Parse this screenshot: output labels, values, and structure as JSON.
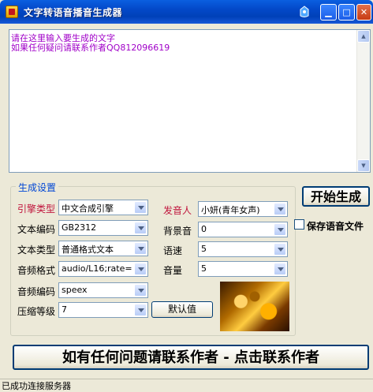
{
  "window": {
    "title": "文字转语音播音生成器"
  },
  "textarea": {
    "lines": [
      "请在这里输入要生成的文字",
      "如果任何疑问请联系作者QQ812096619"
    ]
  },
  "settings": {
    "group_title": "生成设置",
    "engine": {
      "label": "引擎类型",
      "value": "中文合成引擎"
    },
    "text_encoding": {
      "label": "文本编码",
      "value": "GB2312"
    },
    "text_type": {
      "label": "文本类型",
      "value": "普通格式文本"
    },
    "audio_format": {
      "label": "音频格式",
      "value": "audio/L16;rate="
    },
    "audio_encoding": {
      "label": "音频编码",
      "value": "speex"
    },
    "compression": {
      "label": "压缩等级",
      "value": "7"
    },
    "speaker": {
      "label": "发音人",
      "value": "小妍(青年女声)"
    },
    "bg_sound": {
      "label": "背景音",
      "value": "0"
    },
    "speed": {
      "label": "语速",
      "value": "5"
    },
    "volume": {
      "label": "音量",
      "value": "5"
    },
    "default_button": "默认值"
  },
  "start_button": "开始生成",
  "save_voice": {
    "label": "保存语音文件",
    "checked": false
  },
  "contact_button": "如有任何问题请联系作者 - 点击联系作者",
  "status_bar": "已成功连接服务器"
}
